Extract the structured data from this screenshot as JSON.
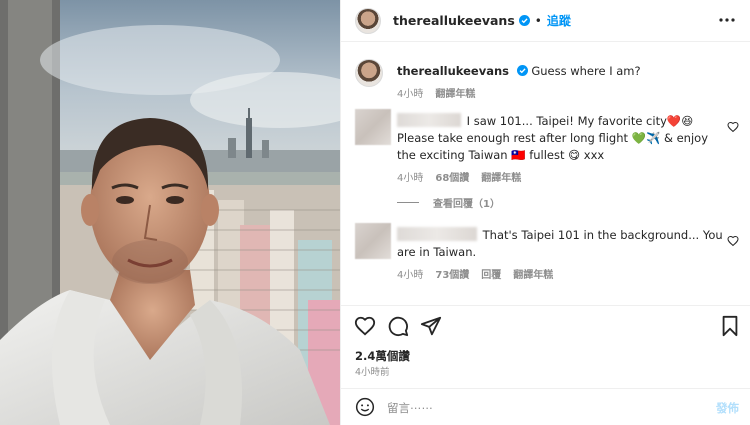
{
  "post": {
    "username": "thereallukeevans",
    "follow_label": "追蹤",
    "caption_text": "Guess where I am?",
    "caption_time": "4小時",
    "caption_translate": "翻譯年糕"
  },
  "comments": [
    {
      "text": "I saw 101... Taipei! My favorite city❤️😆 Please take enough rest after long flight 💚✈️ & enjoy the exciting Taiwan 🇹🇼 fullest 😋 xxx",
      "time": "4小時",
      "likes": "68個讚",
      "translate": "翻譯年糕"
    },
    {
      "text": "That's Taipei 101 in the background... You are in Taiwan.",
      "time": "4小時",
      "likes": "73個讚",
      "reply": "回覆",
      "translate": "翻譯年糕"
    }
  ],
  "view_replies": "查看回覆（1）",
  "engagement": {
    "likes": "2.4萬個讚",
    "time": "4小時前"
  },
  "comment_box": {
    "placeholder": "留言⋯⋯",
    "post_label": "發佈"
  },
  "colors": {
    "accent": "#0095f6",
    "muted": "#8e8e8e",
    "text": "#262626",
    "heart": "#ed4956"
  },
  "icons": [
    "verified-icon",
    "more-options-icon",
    "heart-icon",
    "comment-icon",
    "share-icon",
    "bookmark-icon",
    "emoji-icon"
  ]
}
